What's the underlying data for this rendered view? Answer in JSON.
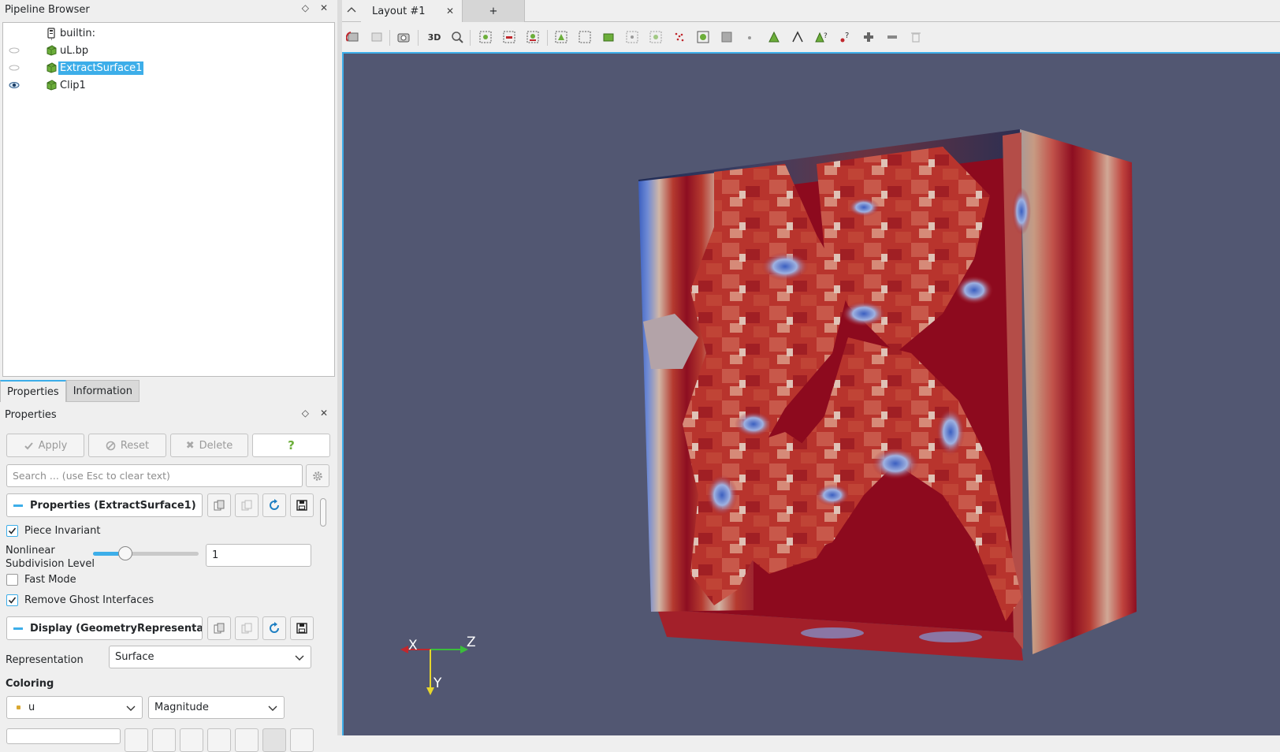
{
  "pipeline_browser": {
    "title": "Pipeline Browser",
    "items": [
      {
        "label": "builtin:",
        "eye": "none"
      },
      {
        "label": "uL.bp",
        "eye": "hidden"
      },
      {
        "label": "ExtractSurface1",
        "eye": "hidden",
        "selected": true
      },
      {
        "label": "Clip1",
        "eye": "visible"
      }
    ]
  },
  "tabs": {
    "properties": "Properties",
    "information": "Information"
  },
  "properties_panel": {
    "title": "Properties",
    "apply": "Apply",
    "reset": "Reset",
    "delete": "Delete",
    "help": "?",
    "search_placeholder": "Search ... (use Esc to clear text)",
    "section_properties": "Properties (ExtractSurface1)",
    "piece_invariant": "Piece Invariant",
    "piece_invariant_checked": true,
    "nonlinear_label_1": "Nonlinear",
    "nonlinear_label_2": "Subdivision Level",
    "nonlinear_value": "1",
    "nonlinear_slider_fraction": 0.28,
    "fast_mode": "Fast Mode",
    "fast_mode_checked": false,
    "remove_ghost": "Remove Ghost Interfaces",
    "remove_ghost_checked": true,
    "section_display": "Display (GeometryRepresentation)",
    "representation_label": "Representation",
    "representation_value": "Surface",
    "coloring_label": "Coloring",
    "coloring_array": "u",
    "coloring_component": "Magnitude"
  },
  "layout": {
    "tab_label": "Layout #1",
    "add_tab": "+",
    "toolbar_3d": "3D"
  },
  "axes": {
    "x": "X",
    "y": "Y",
    "z": "Z"
  },
  "colors": {
    "accent": "#3daee9",
    "viewport_bg": "#525772",
    "field_red": "#8b0a1c",
    "field_blue": "#3b5fc0"
  }
}
